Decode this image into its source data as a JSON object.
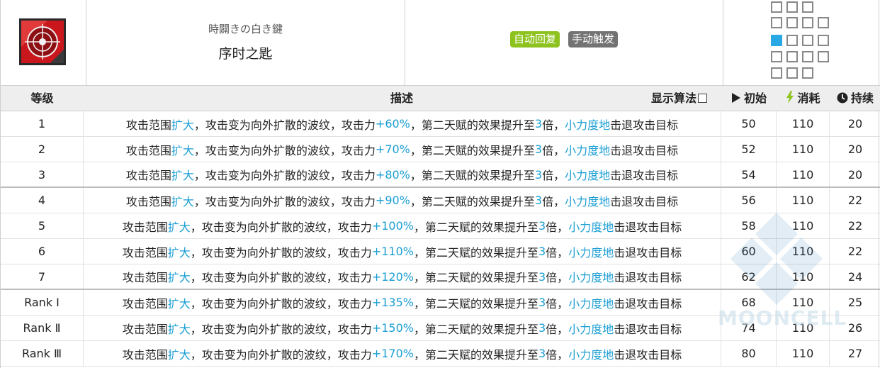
{
  "skill": {
    "name_jp": "時闢きの白き鍵",
    "name_cn": "序时之匙",
    "icon": "skill-crosshair-icon",
    "tags": [
      {
        "label": "自动回复",
        "color": "#8ec31f"
      },
      {
        "label": "手动触发",
        "color": "#737373"
      }
    ],
    "range_icon": "attack-range-grid-icon"
  },
  "table": {
    "headers": {
      "level": "等级",
      "desc": "描述",
      "show_algo": "显示算法",
      "init": "初始",
      "cost": "消耗",
      "duration": "持续"
    },
    "desc_parts": {
      "p1": "攻击范围",
      "hl1": "扩大",
      "p2": "，攻击变为向外扩散的波纹，攻击力",
      "p3": "，第二天赋的效果提升至",
      "hl3": "3",
      "p4": "倍，",
      "hl4": "小力度地",
      "p5": "击退攻击目标"
    },
    "rows": [
      {
        "level": "1",
        "atk": "+60%",
        "init": "50",
        "cost": "110",
        "duration": "20"
      },
      {
        "level": "2",
        "atk": "+70%",
        "init": "52",
        "cost": "110",
        "duration": "20"
      },
      {
        "level": "3",
        "atk": "+80%",
        "init": "54",
        "cost": "110",
        "duration": "20"
      },
      {
        "level": "4",
        "atk": "+90%",
        "init": "56",
        "cost": "110",
        "duration": "22"
      },
      {
        "level": "5",
        "atk": "+100%",
        "init": "58",
        "cost": "110",
        "duration": "22"
      },
      {
        "level": "6",
        "atk": "+110%",
        "init": "60",
        "cost": "110",
        "duration": "22"
      },
      {
        "level": "7",
        "atk": "+120%",
        "init": "62",
        "cost": "110",
        "duration": "24"
      },
      {
        "level": "Rank Ⅰ",
        "atk": "+135%",
        "init": "68",
        "cost": "110",
        "duration": "25"
      },
      {
        "level": "Rank Ⅱ",
        "atk": "+150%",
        "init": "74",
        "cost": "110",
        "duration": "26"
      },
      {
        "level": "Rank Ⅲ",
        "atk": "+170%",
        "init": "80",
        "cost": "110",
        "duration": "27"
      }
    ]
  },
  "watermark": "MOONCELL",
  "colors": {
    "highlight": "#1a9ed4",
    "header_bg": "#eeeeee",
    "range_self": "#28a9e5",
    "cost_icon": "#8ec31f"
  }
}
